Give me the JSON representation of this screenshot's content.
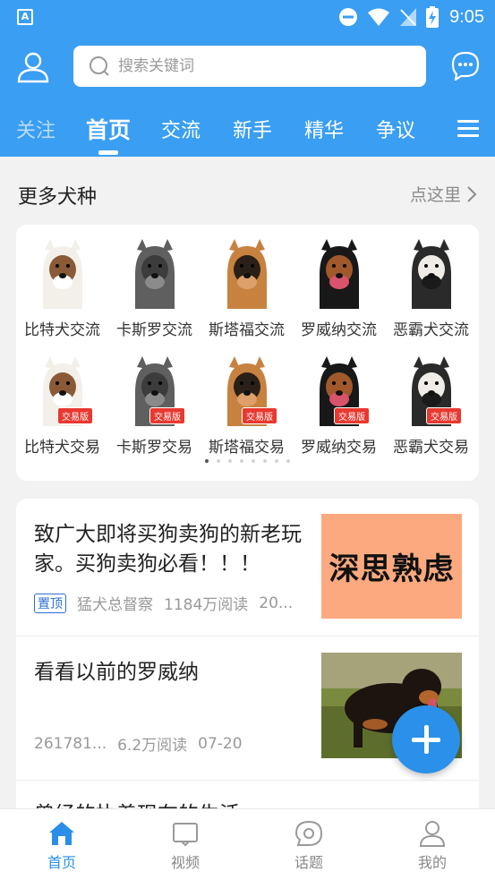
{
  "status_bar": {
    "time": "9:05",
    "app_badge": "A"
  },
  "search": {
    "placeholder": "搜索关键词"
  },
  "tabs": [
    {
      "label": "关注"
    },
    {
      "label": "首页"
    },
    {
      "label": "交流"
    },
    {
      "label": "新手"
    },
    {
      "label": "精华"
    },
    {
      "label": "争议"
    }
  ],
  "breeds_section": {
    "title": "更多犬种",
    "more_label": "点这里",
    "trade_tag": "交易版",
    "items": [
      {
        "name": "比特犬交流",
        "icon": "pitbull"
      },
      {
        "name": "卡斯罗交流",
        "icon": "cane-corso"
      },
      {
        "name": "斯塔福交流",
        "icon": "staffordshire"
      },
      {
        "name": "罗威纳交流",
        "icon": "rottweiler"
      },
      {
        "name": "恶霸犬交流",
        "icon": "american-bully"
      },
      {
        "name": "比特犬交易",
        "icon": "pitbull"
      },
      {
        "name": "卡斯罗交易",
        "icon": "cane-corso"
      },
      {
        "name": "斯塔福交易",
        "icon": "staffordshire"
      },
      {
        "name": "罗威纳交易",
        "icon": "rottweiler"
      },
      {
        "name": "恶霸犬交易",
        "icon": "american-bully"
      }
    ],
    "page_count": 8,
    "current_page": 1
  },
  "posts": [
    {
      "title": "致广大即将买狗卖狗的新老玩家。买狗卖狗必看！！！",
      "badge": "置顶",
      "author": "猛犬总督察",
      "reads": "1184万阅读",
      "date": "20...",
      "thumb_text": "深思熟虑"
    },
    {
      "title": "看看以前的罗威纳",
      "author": "261781...",
      "reads": "6.2万阅读",
      "date": "07-20"
    },
    {
      "title": "曾经的执着现在的生活"
    }
  ],
  "bottom_nav": [
    {
      "label": "首页",
      "icon": "home-icon"
    },
    {
      "label": "视频",
      "icon": "video-icon"
    },
    {
      "label": "话题",
      "icon": "topic-icon"
    },
    {
      "label": "我的",
      "icon": "profile-icon"
    }
  ],
  "colors": {
    "brand": "#3a9ef2",
    "accent": "#2a8fe9",
    "trade_tag": "#e8382f"
  }
}
